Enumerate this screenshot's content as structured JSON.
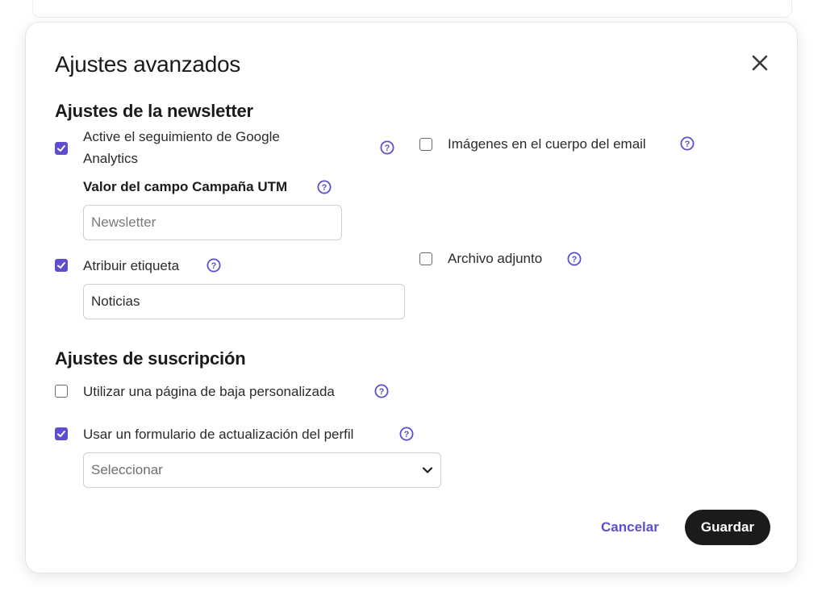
{
  "modal": {
    "title": "Ajustes avanzados",
    "close_icon": "close-icon"
  },
  "newsletter": {
    "section_title": "Ajustes de la newsletter",
    "google_analytics": {
      "label": "Active el seguimiento de Google Analytics",
      "checked": true
    },
    "utm_campaign": {
      "label": "Valor del campo Campaña UTM",
      "placeholder": "Newsletter",
      "value": ""
    },
    "assign_tag": {
      "label": "Atribuir etiqueta",
      "checked": true,
      "value": "Noticias"
    },
    "images_in_body": {
      "label": "Imágenes en el cuerpo del email",
      "checked": false
    },
    "attachment": {
      "label": "Archivo adjunto",
      "checked": false
    }
  },
  "subscription": {
    "section_title": "Ajustes de suscripción",
    "custom_unsubscribe": {
      "label": "Utilizar una página de baja personalizada",
      "checked": false
    },
    "profile_update_form": {
      "label": "Usar un formulario de actualización del perfil",
      "checked": true,
      "selected": "Seleccionar"
    }
  },
  "footer": {
    "cancel_label": "Cancelar",
    "save_label": "Guardar"
  },
  "colors": {
    "accent": "#5b4fcf",
    "primary_button": "#1b1b1b"
  }
}
